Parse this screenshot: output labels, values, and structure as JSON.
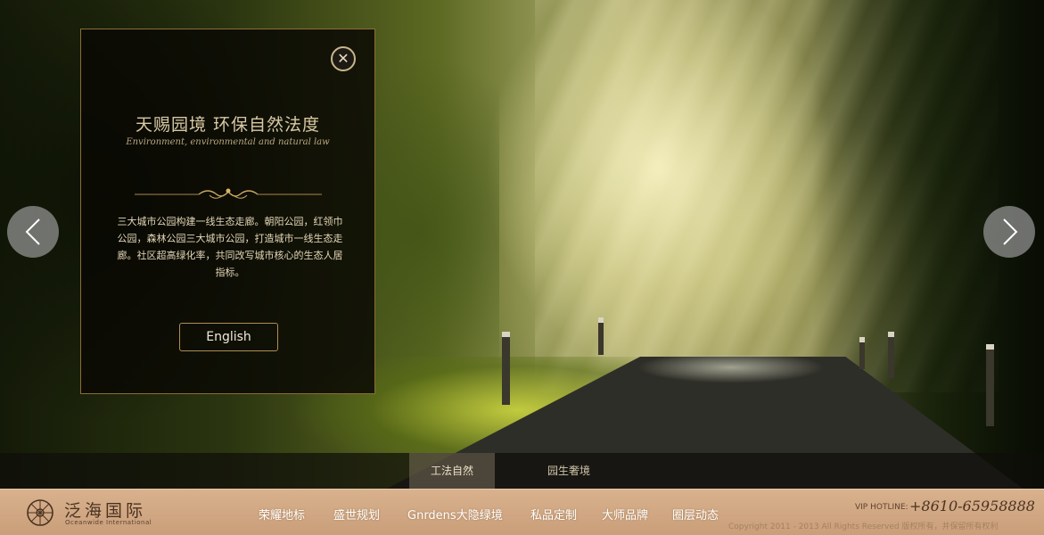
{
  "panel": {
    "close_symbol": "✕",
    "title": "天赐园境  环保自然法度",
    "subtitle": "Environment, environmental and natural law",
    "body": "三大城市公园构建一线生态走廊。朝阳公园，红领巾公园，森林公园三大城市公园，打造城市一线生态走廊。社区超高绿化率，共同改写城市核心的生态人居指标。",
    "button_label": "English"
  },
  "arrows": {
    "prev_icon": "chevron-left-icon",
    "next_icon": "chevron-right-icon"
  },
  "subtabs": [
    {
      "label": "工法自然",
      "active": true
    },
    {
      "label": "园生奢境",
      "active": false
    }
  ],
  "footer": {
    "logo_cn": "泛海国际",
    "logo_en": "Oceanwide International",
    "nav": [
      "荣耀地标",
      "盛世规划",
      "Gnrdens大隐绿境",
      "私品定制",
      "大师品牌",
      "圈层动态"
    ],
    "hotline_label": "VIP HOTLINE:",
    "hotline_number": "+8610-65958888",
    "copyright": "Copyright  2011 - 2013 All Rights Reserved 版权所有，并保留所有权利"
  },
  "colors": {
    "panel_border": "#8b6d35",
    "footer_bg": "#d9b18d",
    "panel_text": "#d9c9a4"
  }
}
